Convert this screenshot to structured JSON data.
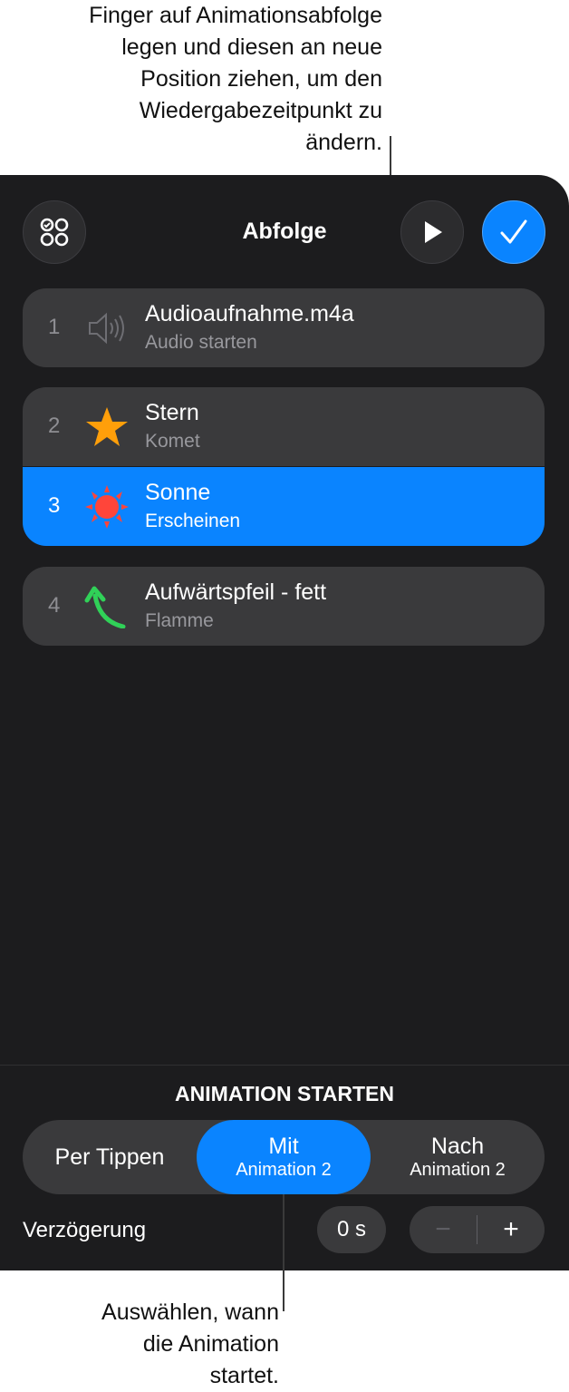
{
  "callouts": {
    "top": "Finger auf Animationsabfolge\nlegen und diesen an neue\nPosition ziehen, um den\nWiedergabezeitpunkt zu\nändern.",
    "bottom": "Auswählen, wann\ndie Animation\nstartet."
  },
  "header": {
    "title": "Abfolge",
    "left_icon": "grid-circles-icon",
    "play_icon": "play-icon",
    "done_icon": "checkmark-icon"
  },
  "rows": [
    {
      "num": "1",
      "title": "Audioaufnahme.m4a",
      "subtitle": "Audio starten",
      "icon": "speaker-icon"
    },
    {
      "num": "2",
      "title": "Stern",
      "subtitle": "Komet",
      "icon": "star-icon"
    },
    {
      "num": "3",
      "title": "Sonne",
      "subtitle": "Erscheinen",
      "icon": "sun-icon"
    },
    {
      "num": "4",
      "title": "Aufwärtspfeil - fett",
      "subtitle": "Flamme",
      "icon": "arrow-up-curved-icon"
    }
  ],
  "start": {
    "heading": "ANIMATION STARTEN",
    "options": [
      {
        "main": "Per Tippen",
        "sub": ""
      },
      {
        "main": "Mit",
        "sub": "Animation 2"
      },
      {
        "main": "Nach",
        "sub": "Animation 2"
      }
    ],
    "selected": "Mit"
  },
  "delay": {
    "label": "Verzögerung",
    "value": "0 s",
    "minus": "−",
    "plus": "+"
  },
  "colors": {
    "accent": "#0a84ff",
    "panel": "#1c1c1e",
    "row": "#3a3a3c",
    "star": "#ff9f0a",
    "sun": "#ff453a",
    "arrow": "#30d158"
  }
}
